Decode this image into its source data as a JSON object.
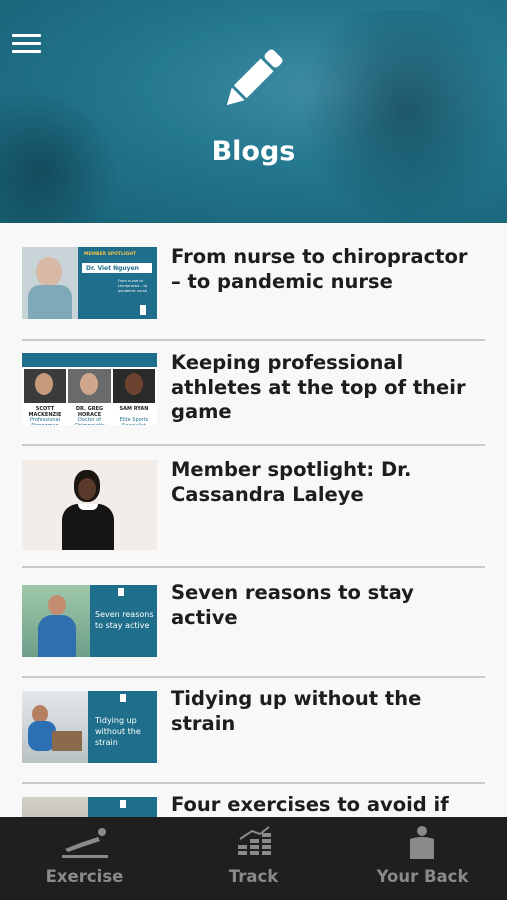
{
  "header": {
    "title": "Blogs",
    "menu_icon": "hamburger-menu-icon",
    "hero_icon": "pencil-icon",
    "accent_color": "#1f7590"
  },
  "posts": [
    {
      "title": "From nurse to chiropractor – to pandemic nurse",
      "thumb": {
        "banner": "MEMBER SPOTLIGHT",
        "name": "Dr. Viet Nguyen",
        "caption": "From nurse to chiropractor - to pandemic nurse"
      }
    },
    {
      "title": "Keeping professional athletes at the top of their game",
      "thumb": {
        "people": [
          {
            "name": "SCOTT MACKENZIE",
            "role": "Professional Strongman"
          },
          {
            "name": "DR. GREG HORACE",
            "role": "Doctor of Chiropractic"
          },
          {
            "name": "SAM RYAN",
            "role": "Elite Sports Specialist"
          }
        ]
      }
    },
    {
      "title": "Member spotlight: Dr. Cassandra Laleye",
      "thumb": {}
    },
    {
      "title": "Seven reasons to stay active",
      "thumb": {
        "caption": "Seven reasons to stay active"
      }
    },
    {
      "title": "Tidying up without the strain",
      "thumb": {
        "caption": "Tidying up without the strain"
      }
    },
    {
      "title": "Four exercises to avoid if",
      "thumb": {}
    }
  ],
  "nav": [
    {
      "label": "Exercise",
      "icon": "exercise-icon"
    },
    {
      "label": "Track",
      "icon": "track-chart-icon"
    },
    {
      "label": "Your Back",
      "icon": "back-body-icon"
    }
  ]
}
